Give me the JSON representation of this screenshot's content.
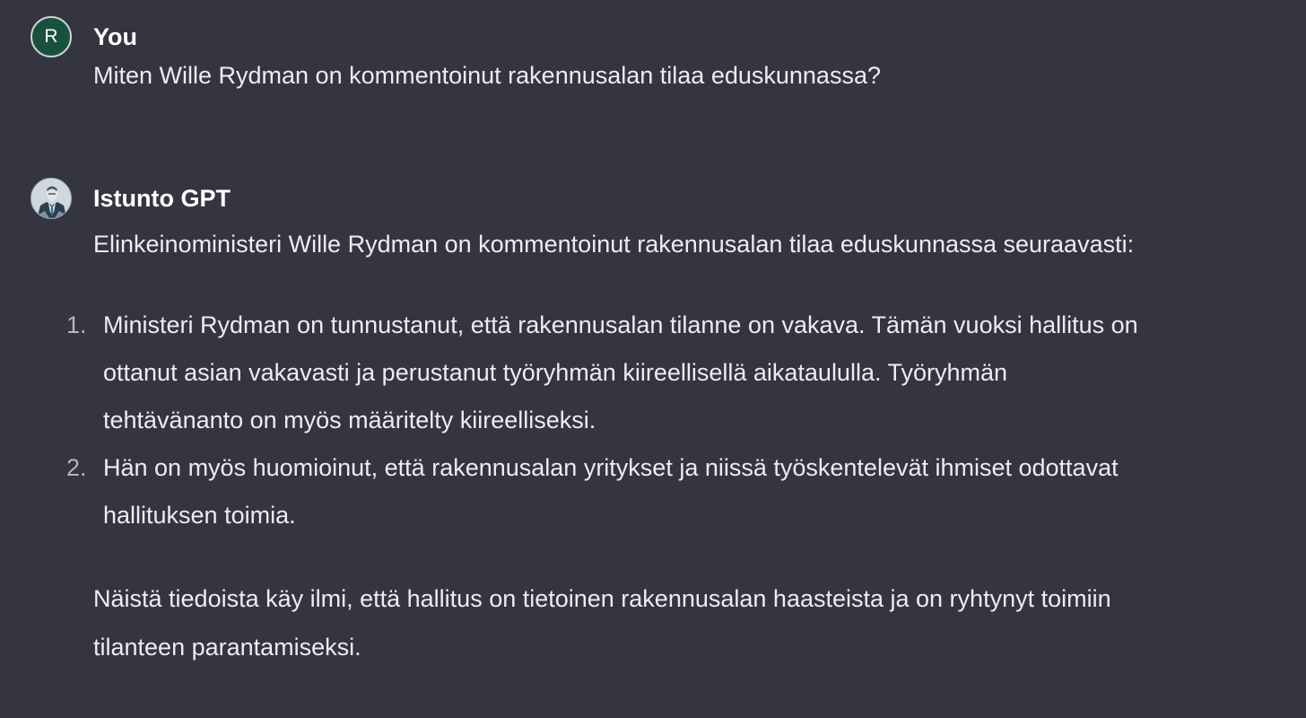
{
  "user_message": {
    "avatar_letter": "R",
    "sender": "You",
    "text": "Miten Wille Rydman on kommentoinut rakennusalan tilaa eduskunnassa?"
  },
  "gpt_message": {
    "avatar_icon": "istunto-gpt-avatar",
    "sender": "Istunto GPT",
    "intro": "Elinkeinoministeri Wille Rydman on kommentoinut rakennusalan tilaa eduskunnassa seuraavasti:",
    "list": [
      {
        "number": "1.",
        "lines": [
          "Ministeri Rydman on tunnustanut, että rakennusalan tilanne on vakava. Tämän vuoksi hallitus on",
          "ottanut asian vakavasti ja perustanut työryhmän kiireellisellä aikataululla. Työryhmän",
          "tehtävänanto on myös määritelty kiireelliseksi."
        ]
      },
      {
        "number": "2.",
        "lines": [
          "Hän on myös huomioinut, että rakennusalan yritykset ja niissä työskentelevät ihmiset odottavat",
          "hallituksen toimia."
        ]
      }
    ],
    "closing_lines": [
      "Näistä tiedoista käy ilmi, että hallitus on tietoinen rakennusalan haasteista ja on ryhtynyt toimiin",
      "tilanteen parantamiseksi."
    ]
  },
  "colors": {
    "background": "#343541",
    "text": "#ececf1",
    "user_avatar": "#19503f"
  }
}
